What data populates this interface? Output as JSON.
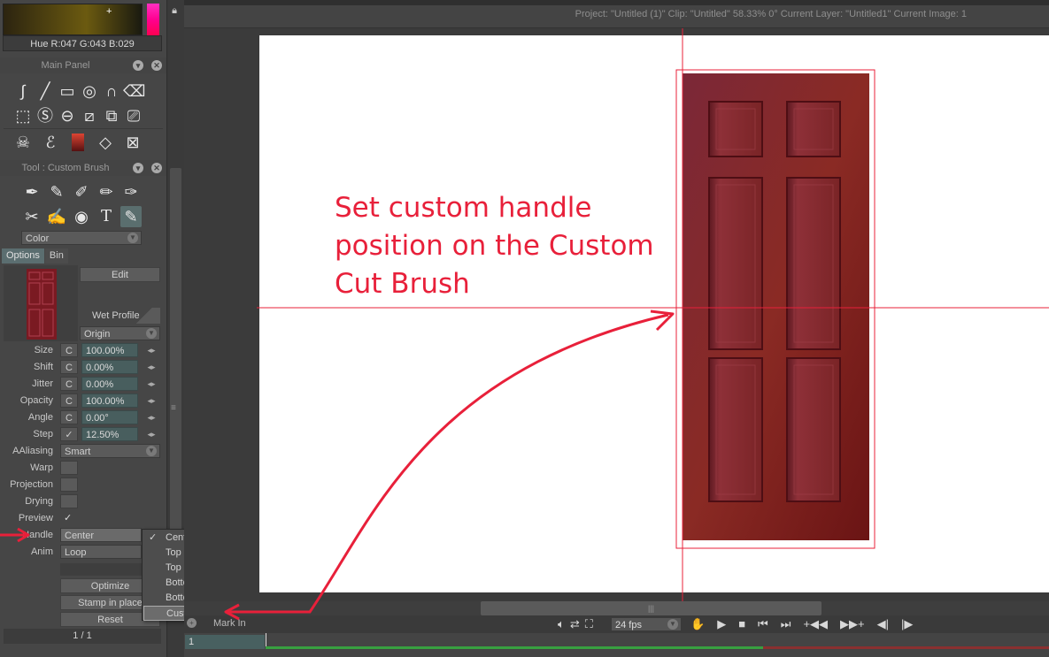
{
  "color": {
    "readout": "Hue R:047 G:043 B:029"
  },
  "main_panel": {
    "title": "Main Panel",
    "tools": [
      [
        "brush-stroke-icon",
        "line-icon",
        "rectangle-icon",
        "ellipse-icon",
        "bezier-icon",
        "eraser-icon"
      ],
      [
        "marquee-icon",
        "selection-s-icon",
        "circle-minus-icon",
        "crop-icon",
        "transform-icon",
        "camera-icon"
      ],
      [
        "skull-icon",
        "swirl-icon",
        "gradient-icon",
        "paper-icon",
        "texture-icon"
      ]
    ]
  },
  "tool_panel": {
    "title": "Tool : Custom Brush",
    "brushes": [
      [
        "pen-nib-icon",
        "marker-icon",
        "wide-marker-icon",
        "felt-pen-icon",
        "airbrush-icon"
      ],
      [
        "smudge-icon",
        "calligraphy-icon",
        "drop-icon",
        "text-tool-icon",
        "custom-brush-icon"
      ]
    ],
    "color_dropdown": "Color",
    "tabs": [
      "Options",
      "Bin"
    ],
    "edit_button": "Edit",
    "wet_profile": "Wet Profile",
    "origin_dropdown": "Origin",
    "params": [
      {
        "label": "Size",
        "mode": "C",
        "value": "100.00%"
      },
      {
        "label": "Shift",
        "mode": "C",
        "value": "0.00%"
      },
      {
        "label": "Jitter",
        "mode": "C",
        "value": "0.00%"
      },
      {
        "label": "Opacity",
        "mode": "C",
        "value": "100.00%"
      },
      {
        "label": "Angle",
        "mode": "C",
        "value": "0.00°"
      },
      {
        "label": "Step",
        "mode": "✓",
        "value": "12.50%"
      }
    ],
    "aaliasing_label": "AAliasing",
    "aaliasing_value": "Smart",
    "warp_label": "Warp",
    "projection_label": "Projection",
    "drying_label": "Drying",
    "preview_label": "Preview",
    "preview_check": "✓",
    "handle_label": "Handle",
    "handle_value": "Center",
    "anim_label": "Anim",
    "anim_value": "Loop",
    "optimize_button": "Optimize",
    "stamp_button": "Stamp in place",
    "reset_button": "Reset",
    "page_indicator": "1 / 1"
  },
  "handle_menu": {
    "items": [
      "Center",
      "Top Left",
      "Top Right",
      "Bottom Left",
      "Bottom Right",
      "Custom"
    ],
    "checked": "Center",
    "highlighted": "Custom",
    "check_mark": "✓"
  },
  "status": {
    "text": "Project:  \"Untitled (1)\"  Clip: \"Untitled\"   58.33%   0°  Current Layer: \"Untitled1\"  Current Image: 1"
  },
  "annotation": {
    "line1": "Set custom handle",
    "line2": "position on the Custom",
    "line3": "Cut Brush"
  },
  "transport": {
    "mark_in": "Mark In",
    "fps": "24 fps",
    "frame": "1"
  },
  "colors": {
    "annotation": "#e8203a",
    "field": "#485e5e",
    "panel": "#464646"
  }
}
